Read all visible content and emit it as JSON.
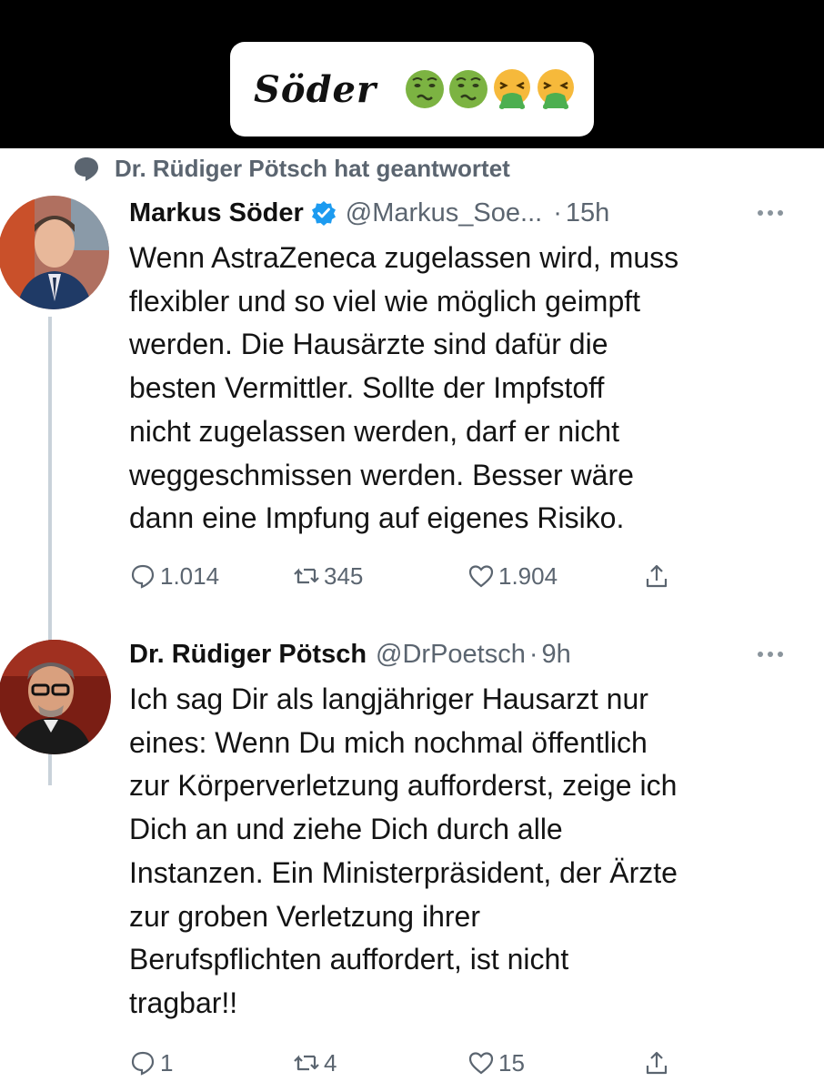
{
  "header": {
    "title": "Söder",
    "emojis": [
      "nauseated-face-icon",
      "nauseated-face-icon",
      "vomiting-face-icon",
      "vomiting-face-icon"
    ]
  },
  "reply_context": {
    "text": "Dr. Rüdiger Pötsch hat geantwortet"
  },
  "tweets": [
    {
      "name": "Markus Söder",
      "verified": true,
      "handle": "@Markus_Soe...",
      "separator": "·",
      "time": "15h",
      "body_lines": [
        "Wenn AstraZeneca zugelassen wird, muss",
        "flexibler und so viel wie möglich geimpft",
        "werden. Die Hausärzte sind dafür die",
        "besten Vermittler. Sollte der Impfstoff",
        "nicht zugelassen werden, darf er nicht",
        "weggeschmissen werden. Besser wäre",
        "dann eine Impfung auf eigenes Risiko."
      ],
      "replies": "1.014",
      "retweets": "345",
      "likes": "1.904"
    },
    {
      "name": "Dr. Rüdiger Pötsch",
      "verified": false,
      "handle": "@DrPoetsch",
      "separator": "·",
      "time": "9h",
      "body_lines": [
        "Ich sag Dir als langjähriger Hausarzt nur",
        "eines: Wenn Du mich nochmal öffentlich",
        "zur Körperverletzung aufforderst, zeige ich",
        "Dich an und ziehe Dich durch alle",
        "Instanzen. Ein Ministerpräsident, der Ärzte",
        "zur groben Verletzung ihrer",
        "Berufspflichten auffordert, ist nicht",
        "tragbar!!"
      ],
      "replies": "1",
      "retweets": "4",
      "likes": "15"
    }
  ],
  "colors": {
    "secondary_text": "#5b6570",
    "verified_blue": "#1d9bf0",
    "thread_line": "#c9d2da"
  }
}
